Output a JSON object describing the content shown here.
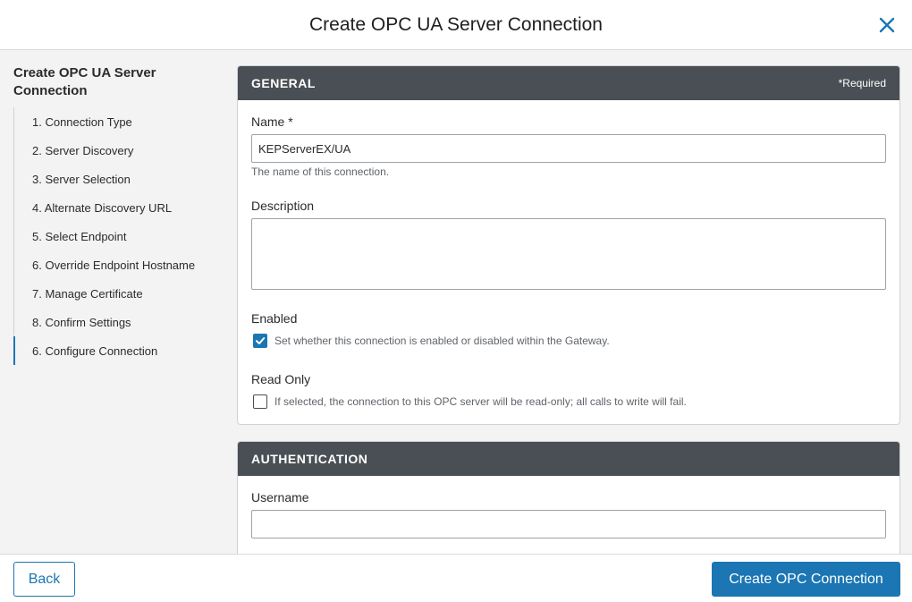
{
  "dialog": {
    "title": "Create OPC UA Server Connection",
    "close_icon": "close-icon"
  },
  "sidebar": {
    "title": "Create OPC UA Server Connection",
    "steps": [
      {
        "label": "1. Connection Type"
      },
      {
        "label": "2. Server Discovery"
      },
      {
        "label": "3. Server Selection"
      },
      {
        "label": "4. Alternate Discovery URL"
      },
      {
        "label": "5. Select Endpoint"
      },
      {
        "label": "6. Override Endpoint Hostname"
      },
      {
        "label": "7. Manage Certificate"
      },
      {
        "label": "8. Confirm Settings"
      },
      {
        "label": "6. Configure Connection",
        "active": true
      }
    ]
  },
  "general": {
    "heading": "GENERAL",
    "required_note": "*Required",
    "name_label": "Name *",
    "name_value": "KEPServerEX/UA",
    "name_help": "The name of this connection.",
    "description_label": "Description",
    "description_value": "",
    "enabled_label": "Enabled",
    "enabled_checked": true,
    "enabled_help": "Set whether this connection is enabled or disabled within the Gateway.",
    "readonly_label": "Read Only",
    "readonly_checked": false,
    "readonly_help": "If selected, the connection to this OPC server will be read-only; all calls to write will fail."
  },
  "authentication": {
    "heading": "AUTHENTICATION",
    "username_label": "Username",
    "username_value": ""
  },
  "footer": {
    "back_label": "Back",
    "create_label": "Create OPC Connection"
  },
  "colors": {
    "accent": "#1b76b3",
    "panel_header": "#4a4f55",
    "background": "#f3f3f4"
  }
}
